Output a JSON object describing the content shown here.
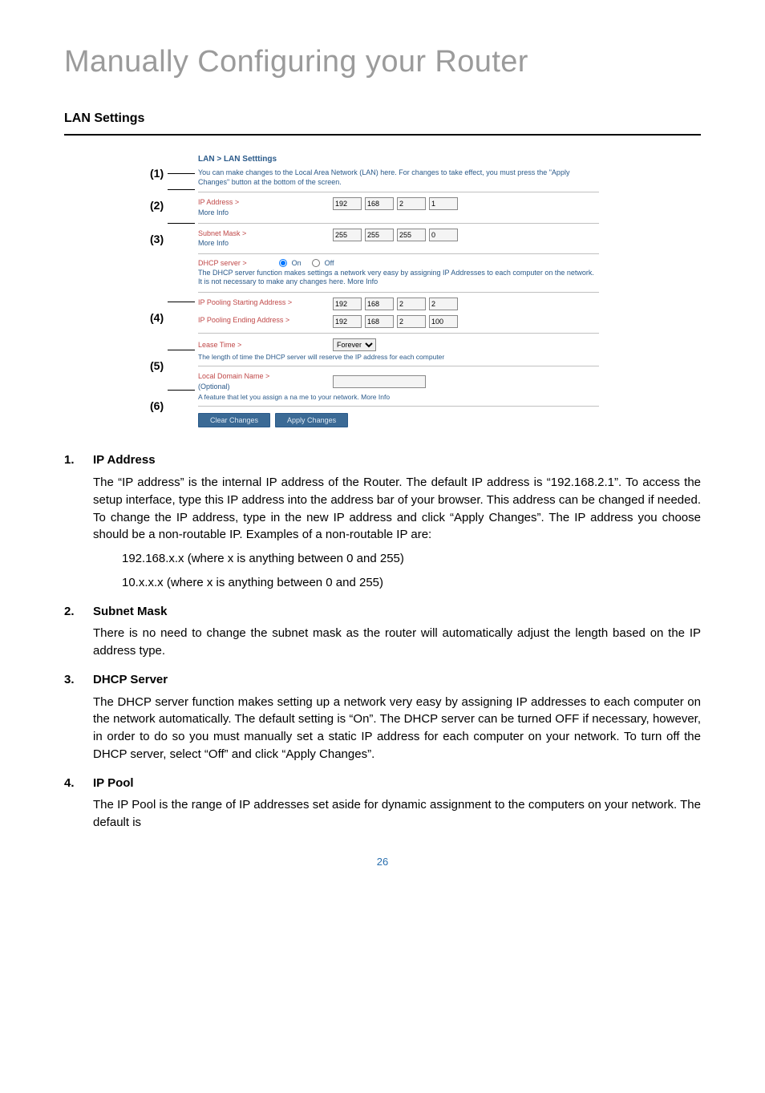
{
  "page_title": "Manually Configuring your Router",
  "section_title": "LAN Settings",
  "callouts": [
    "(1)",
    "(2)",
    "(3)",
    "(4)",
    "(5)",
    "(6)"
  ],
  "panel": {
    "title": "LAN > LAN Setttings",
    "desc": "You can make changes to the Local Area Network (LAN) here. For changes to take effect, you must press the \"Apply Changes\" button at the bottom of the screen.",
    "ip_label": "IP Address >",
    "more_info": "More Info",
    "ip_vals": [
      "192",
      "168",
      "2",
      "1"
    ],
    "subnet_label": "Subnet Mask >",
    "subnet_vals": [
      "255",
      "255",
      "255",
      "0"
    ],
    "dhcp_label": "DHCP server >",
    "on": "On",
    "off": "Off",
    "dhcp_text": "The DHCP server function makes settings a network very easy by assigning IP Addresses to each computer on the network. It is not necessary to make any changes here. More Info",
    "pool_start_label": "IP Pooling Starting Address >",
    "pool_start_vals": [
      "192",
      "168",
      "2",
      "2"
    ],
    "pool_end_label": "IP Pooling Ending Address >",
    "pool_end_vals": [
      "192",
      "168",
      "2",
      "100"
    ],
    "lease_label": "Lease Time >",
    "lease_val": "Forever",
    "lease_note": "The length of time the DHCP server will reserve the IP address for each computer",
    "local_label": "Local Domain Name >",
    "optional": "(Optional)",
    "local_note": "A feature that let you assign a na me to your network. More Info",
    "btn_clear": "Clear Changes",
    "btn_apply": "Apply Changes"
  },
  "items": [
    {
      "num": "1.",
      "head": "IP Address",
      "body": "The “IP address” is the internal IP address of the Router. The default IP address is “192.168.2.1”. To access the setup interface, type this IP address into the address bar of your browser. This address can be changed if needed. To change the IP address, type in the new IP address and click “Apply Changes”. The IP address you choose should be a non-routable IP. Examples of a non-routable IP are:",
      "sub": [
        "192.168.x.x (where x is anything between 0 and 255)",
        "10.x.x.x (where x is anything between 0 and 255)"
      ]
    },
    {
      "num": "2.",
      "head": "Subnet Mask",
      "body": "There is no need to change the subnet mask as the router will automatically adjust the length based on the IP address type."
    },
    {
      "num": "3.",
      "head": "DHCP Server",
      "body": "The DHCP server function makes setting up a network very easy by assigning IP addresses to each computer on the network automatically. The default setting is “On”. The DHCP server can be turned OFF if necessary, however, in order to do so you must manually set a static IP address for each computer on your network. To turn off the DHCP server, select “Off” and click “Apply Changes”."
    },
    {
      "num": "4.",
      "head": "IP Pool",
      "body": "The IP Pool is the range of IP addresses set aside for dynamic assignment to the computers on your network. The default is"
    }
  ],
  "page_number": "26"
}
